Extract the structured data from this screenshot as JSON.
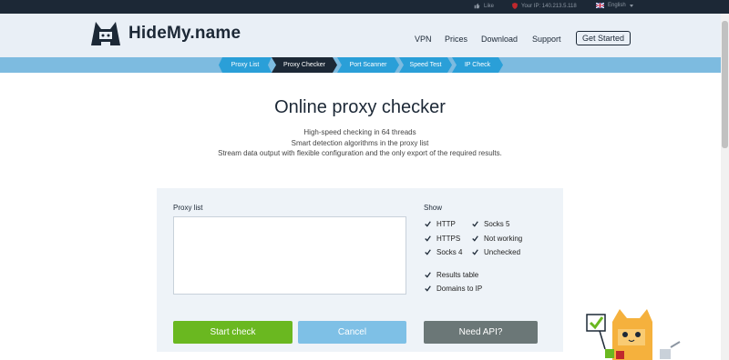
{
  "topbar": {
    "like": "Like",
    "ip": "Your IP: 140.213.5.118",
    "language": "English"
  },
  "header": {
    "logo": "HideMy.name",
    "nav": [
      "VPN",
      "Prices",
      "Download",
      "Support"
    ],
    "get_started": "Get Started"
  },
  "tabs": [
    "Proxy List",
    "Proxy Checker",
    "Port Scanner",
    "Speed Test",
    "IP Check"
  ],
  "hero": {
    "title": "Online proxy checker",
    "lines": [
      "High-speed checking in 64 threads",
      "Smart detection algorithms in the proxy list",
      "Stream data output with flexible configuration and the only export of the required results."
    ]
  },
  "form": {
    "proxy_label": "Proxy list",
    "proxy_value": "",
    "show_label": "Show",
    "options": [
      "HTTP",
      "HTTPS",
      "Socks 4",
      "Socks 5",
      "Not working",
      "Unchecked",
      "Results table",
      "Domains to IP"
    ],
    "start": "Start check",
    "cancel": "Cancel",
    "api": "Need API?"
  },
  "colors": {
    "dark": "#1c2836",
    "tab_blue": "#2a9fd8",
    "green": "#6ab820"
  }
}
